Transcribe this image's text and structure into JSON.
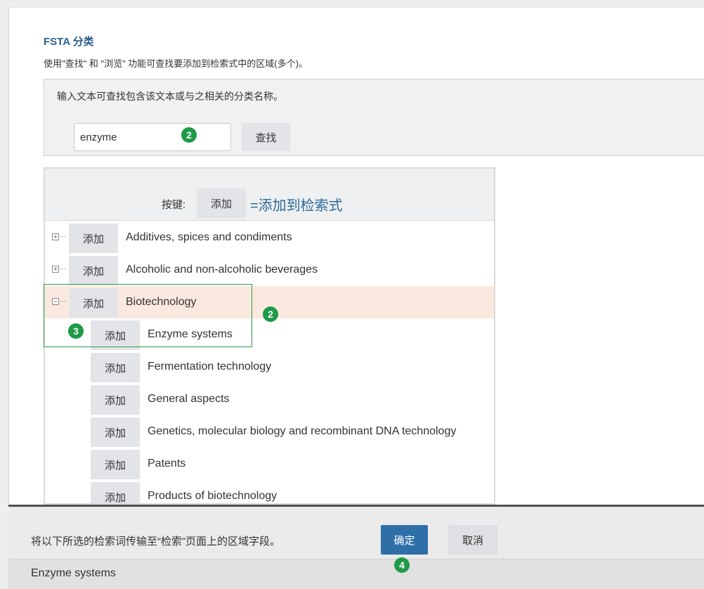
{
  "header": {
    "title": "FSTA 分类",
    "description": "使用\"查找\" 和 \"浏览\" 功能可查找要添加到检索式中的区域(多个)。"
  },
  "find": {
    "instruction": "输入文本可查找包含该文本或与之相关的分类名称。",
    "input_value": "enzyme",
    "button_label": "查找"
  },
  "key": {
    "label": "按键:",
    "button_label": "添加",
    "equals_text": "=添加到检索式"
  },
  "tree": {
    "items": [
      {
        "label": "Additives, spices and condiments",
        "add_label": "添加",
        "expander": "plus-icon"
      },
      {
        "label": "Alcoholic and non-alcoholic beverages",
        "add_label": "添加",
        "expander": "plus-icon"
      },
      {
        "label": "Biotechnology",
        "add_label": "添加",
        "expander": "minus-icon",
        "selected": true
      },
      {
        "label": "Enzyme systems",
        "add_label": "添加"
      },
      {
        "label": "Fermentation technology",
        "add_label": "添加"
      },
      {
        "label": "General aspects",
        "add_label": "添加"
      },
      {
        "label": "Genetics, molecular biology and recombinant DNA technology",
        "add_label": "添加"
      },
      {
        "label": "Patents",
        "add_label": "添加"
      },
      {
        "label": "Products of biotechnology",
        "add_label": "添加"
      }
    ]
  },
  "badges": {
    "search_step": "2",
    "tree_step": "2",
    "child_step": "3",
    "confirm_step": "4"
  },
  "bottom": {
    "transfer_text": "将以下所选的检索词传输至“检索”页面上的区域字段。",
    "ok_label": "确定",
    "cancel_label": "取消",
    "selected_value": "Enzyme systems"
  },
  "colors": {
    "title": "#2c5f8d",
    "ok_button": "#2f6fa8",
    "badge": "#1f9a47",
    "selected_row": "#fbe9df",
    "highlight_border": "#2e9b48"
  }
}
